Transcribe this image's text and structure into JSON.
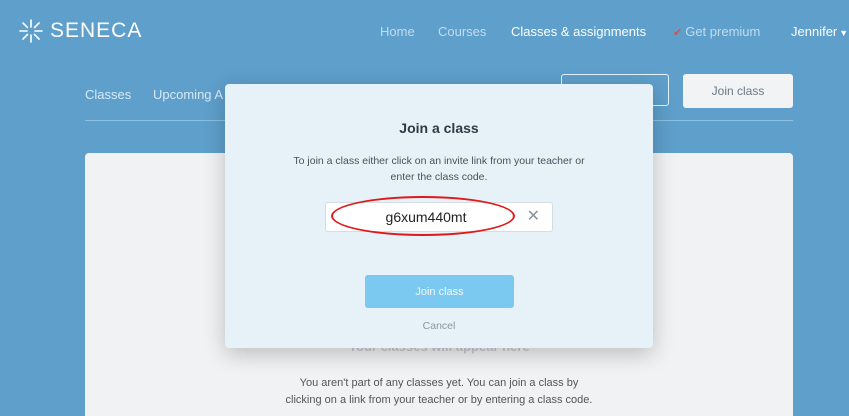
{
  "brand": {
    "name": "SENECA"
  },
  "nav": {
    "home": "Home",
    "courses": "Courses",
    "classes_assignments": "Classes & assignments",
    "premium": "Get premium",
    "user": "Jennifer"
  },
  "subnav": {
    "classes": "Classes",
    "upcoming": "Upcoming A",
    "join_class_button": "Join class"
  },
  "empty_state": {
    "title": "Your classes will appear here",
    "line1": "You aren't part of any classes yet. You can join a class by",
    "line2": "clicking on a link from your teacher or by entering a class code."
  },
  "modal": {
    "title": "Join a class",
    "description_line1": "To join a class either click on an invite link from your teacher or",
    "description_line2": "enter the class code.",
    "code_value": "g6xum440mt",
    "join_button": "Join class",
    "cancel": "Cancel"
  },
  "icons": {
    "logo": "seneca-asterisk-icon",
    "clear": "close-icon",
    "premium": "star-icon",
    "user_menu": "caret-down-icon"
  },
  "colors": {
    "background": "#5e9fcb",
    "modal_bg": "#e6f1f8",
    "primary_button": "#7bc8f0",
    "highlight": "#e01818"
  }
}
